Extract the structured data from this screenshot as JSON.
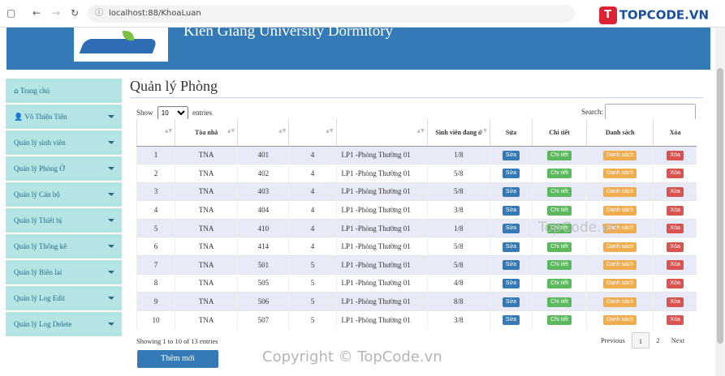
{
  "browser": {
    "url": "localhost:88/KhoaLuan",
    "info_icon": "ⓘ"
  },
  "watermark_logo": "TOPCODE.VN",
  "banner": {
    "title": "Kien Giang University Dormitory"
  },
  "sidebar": {
    "items": [
      {
        "icon": "home-icon",
        "glyph": "⌂",
        "label": "Trang chủ",
        "has_caret": false
      },
      {
        "icon": "user-icon",
        "glyph": "👤",
        "label": "Võ Thiện Tiên",
        "has_caret": true
      },
      {
        "icon": "",
        "glyph": "",
        "label": "Quản lý sinh viên",
        "has_caret": true
      },
      {
        "icon": "",
        "glyph": "",
        "label": "Quản lý Phòng Ở",
        "has_caret": true
      },
      {
        "icon": "",
        "glyph": "",
        "label": "Quản lý Cán bộ",
        "has_caret": true
      },
      {
        "icon": "",
        "glyph": "",
        "label": "Quản lý Thiết bị",
        "has_caret": true
      },
      {
        "icon": "",
        "glyph": "",
        "label": "Quản lý Thống kê",
        "has_caret": true
      },
      {
        "icon": "",
        "glyph": "",
        "label": "Quản lý Biên lai",
        "has_caret": true
      },
      {
        "icon": "",
        "glyph": "",
        "label": "Quản lý Log Edit",
        "has_caret": true
      },
      {
        "icon": "",
        "glyph": "",
        "label": "Quản lý Log Delete",
        "has_caret": true
      }
    ]
  },
  "main": {
    "title": "Quản lý Phòng",
    "length": {
      "show": "Show",
      "value": "10",
      "entries": "entries"
    },
    "search_label": "Search:",
    "columns": [
      "",
      "Tòa nhà",
      "",
      "",
      "",
      "Sinh viên đang ở",
      "Sửa",
      "Chi tiết",
      "Danh sách",
      "Xóa"
    ],
    "buttons": {
      "edit": "Sửa",
      "detail": "Chi tiết",
      "list": "Danh sách",
      "delete": "Xóa"
    },
    "rows": [
      {
        "no": "1",
        "building": "TNA",
        "room": "401",
        "floor": "4",
        "type": "LP1 -Phòng Thường 01",
        "students": "1/8"
      },
      {
        "no": "2",
        "building": "TNA",
        "room": "402",
        "floor": "4",
        "type": "LP1 -Phòng Thường 01",
        "students": "5/8"
      },
      {
        "no": "3",
        "building": "TNA",
        "room": "403",
        "floor": "4",
        "type": "LP1 -Phòng Thường 01",
        "students": "5/8"
      },
      {
        "no": "4",
        "building": "TNA",
        "room": "404",
        "floor": "4",
        "type": "LP1 -Phòng Thường 01",
        "students": "3/8"
      },
      {
        "no": "5",
        "building": "TNA",
        "room": "410",
        "floor": "4",
        "type": "LP1 -Phòng Thường 01",
        "students": "1/8"
      },
      {
        "no": "6",
        "building": "TNA",
        "room": "414",
        "floor": "4",
        "type": "LP1 -Phòng Thường 01",
        "students": "5/8"
      },
      {
        "no": "7",
        "building": "TNA",
        "room": "501",
        "floor": "5",
        "type": "LP1 -Phòng Thường 01",
        "students": "5/8"
      },
      {
        "no": "8",
        "building": "TNA",
        "room": "505",
        "floor": "5",
        "type": "LP1 -Phòng Thường 01",
        "students": "4/8"
      },
      {
        "no": "9",
        "building": "TNA",
        "room": "506",
        "floor": "5",
        "type": "LP1 -Phòng Thường 01",
        "students": "8/8"
      },
      {
        "no": "10",
        "building": "TNA",
        "room": "507",
        "floor": "5",
        "type": "LP1 -Phòng Thường 01",
        "students": "3/8"
      }
    ],
    "info": "Showing 1 to 10 of 13 entries",
    "pager": {
      "prev": "Previous",
      "pages": [
        "1",
        "2"
      ],
      "next": "Next"
    },
    "add_button": "Thêm mới"
  },
  "watermarks": [
    "TopCode.vn",
    "Copyright © TopCode.vn"
  ]
}
